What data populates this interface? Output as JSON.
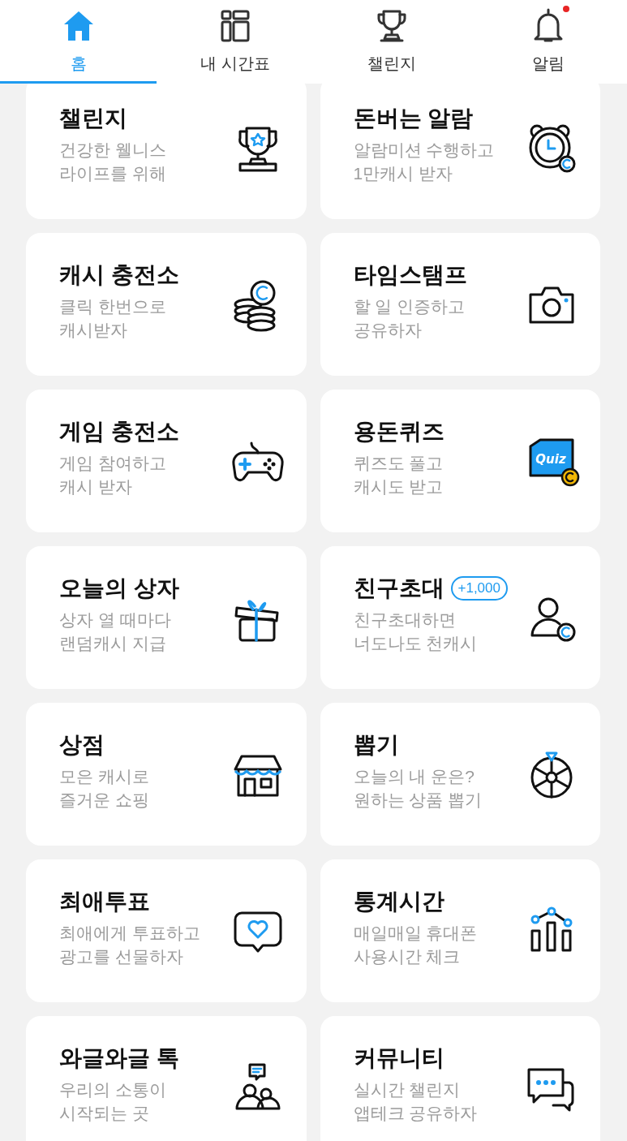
{
  "tabs": [
    {
      "label": "홈",
      "selected": true,
      "unread": false
    },
    {
      "label": "내 시간표",
      "selected": false,
      "unread": false
    },
    {
      "label": "챌린지",
      "selected": false,
      "unread": false
    },
    {
      "label": "알림",
      "selected": false,
      "unread": true
    }
  ],
  "cards": [
    {
      "title": "챌린지",
      "subtitle": [
        "건강한 웰니스",
        "라이프를 위해"
      ]
    },
    {
      "title": "돈버는 알람",
      "subtitle": [
        "알람미션 수행하고",
        "1만캐시 받자"
      ]
    },
    {
      "title": "캐시 충전소",
      "subtitle": [
        "클릭 한번으로",
        "캐시받자"
      ]
    },
    {
      "title": "타임스탬프",
      "subtitle": [
        "할 일 인증하고",
        "공유하자"
      ]
    },
    {
      "title": "게임 충전소",
      "subtitle": [
        "게임 참여하고",
        "캐시 받자"
      ]
    },
    {
      "title": "용돈퀴즈",
      "subtitle": [
        "퀴즈도 풀고",
        "캐시도 받고"
      ],
      "icon_label": "Quiz"
    },
    {
      "title": "오늘의 상자",
      "subtitle": [
        "상자 열 때마다",
        "랜덤캐시 지급"
      ]
    },
    {
      "title": "친구초대",
      "badge": "+1,000",
      "subtitle": [
        "친구초대하면",
        "너도나도 천캐시"
      ]
    },
    {
      "title": "상점",
      "subtitle": [
        "모은 캐시로",
        "즐거운 쇼핑"
      ]
    },
    {
      "title": "뽑기",
      "subtitle": [
        "오늘의 내 운은?",
        "원하는 상품 뽑기"
      ]
    },
    {
      "title": "최애투표",
      "subtitle": [
        "최애에게 투표하고",
        "광고를 선물하자"
      ]
    },
    {
      "title": "통계시간",
      "subtitle": [
        "매일매일 휴대폰",
        "사용시간 체크"
      ]
    },
    {
      "title": "와글와글 톡",
      "subtitle": [
        "우리의 소통이",
        "시작되는 곳"
      ]
    },
    {
      "title": "커뮤니티",
      "subtitle": [
        "실시간 챌린지",
        "앱테크 공유하자"
      ]
    }
  ]
}
